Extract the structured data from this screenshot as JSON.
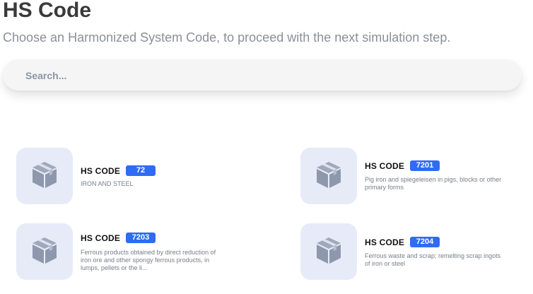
{
  "header": {
    "title": "HS Code",
    "subtitle": "Choose an Harmonized System Code, to proceed with the next simulation step."
  },
  "search": {
    "placeholder": "Search...",
    "value": ""
  },
  "colors": {
    "badge": "#2f6bf5",
    "icon_bg": "#e7ebf8",
    "icon": "#8e98ad"
  },
  "cards": [
    {
      "label": "HS CODE",
      "code": "72",
      "description": "IRON AND STEEL",
      "icon": "package-box-icon"
    },
    {
      "label": "HS CODE",
      "code": "7201",
      "description": "Pig iron and spiegeleisen in pigs, blocks or other primary forms",
      "icon": "package-box-icon"
    },
    {
      "label": "HS CODE",
      "code": "7203",
      "description": "Ferrous products obtained by direct reduction of iron ore and other spongy ferrous products, in lumps, pellets or the li...",
      "icon": "package-box-icon"
    },
    {
      "label": "HS CODE",
      "code": "7204",
      "description": "Ferrous waste and scrap; remelting scrap ingots of iron or steel",
      "icon": "package-box-icon"
    }
  ]
}
